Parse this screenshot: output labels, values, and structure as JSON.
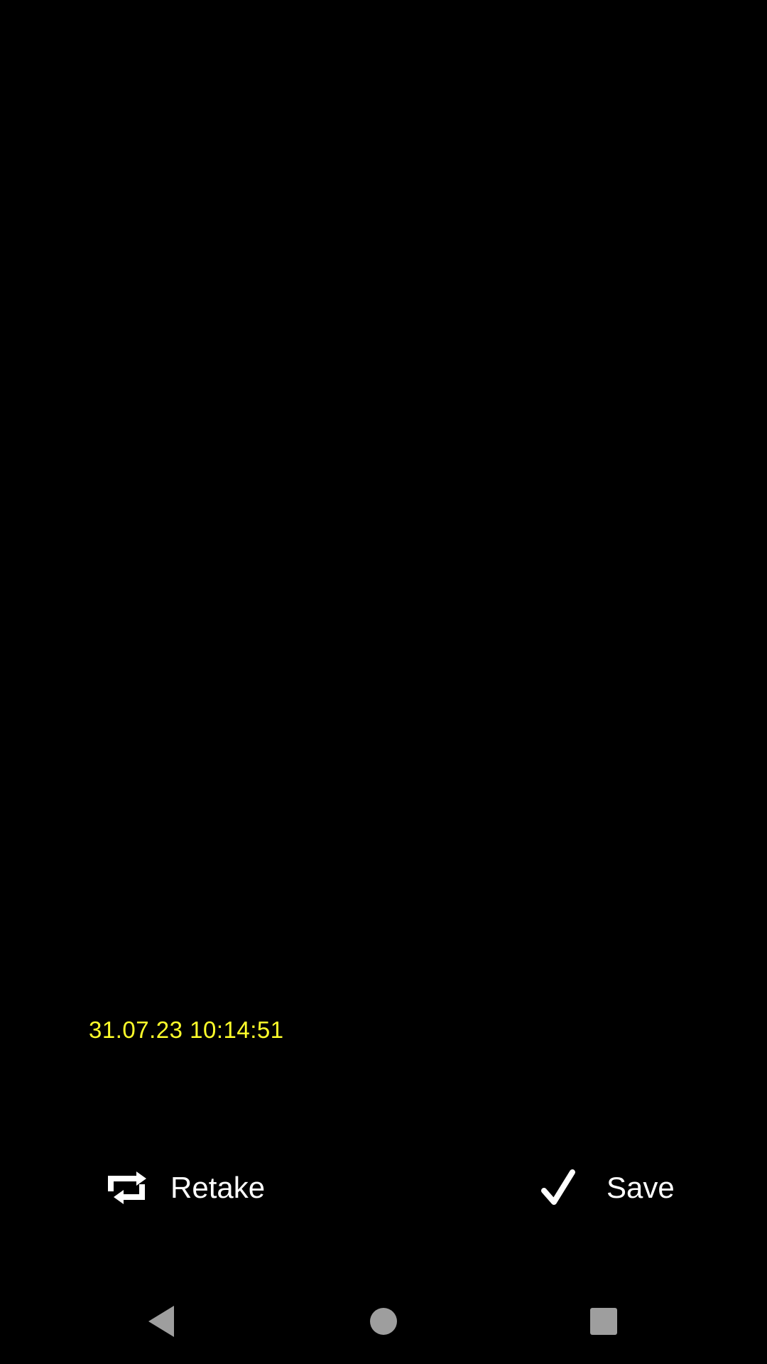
{
  "preview": {
    "timestamp": "31.07.23 10:14:51",
    "timestamp_color": "#ffff2a"
  },
  "actions": {
    "retake_label": "Retake",
    "retake_icon": "repeat-icon",
    "save_label": "Save",
    "save_icon": "checkmark-icon"
  },
  "navigation_bar": {
    "back_icon": "back-triangle-icon",
    "home_icon": "home-circle-icon",
    "recents_icon": "recents-square-icon",
    "icon_color": "#9e9e9e"
  }
}
